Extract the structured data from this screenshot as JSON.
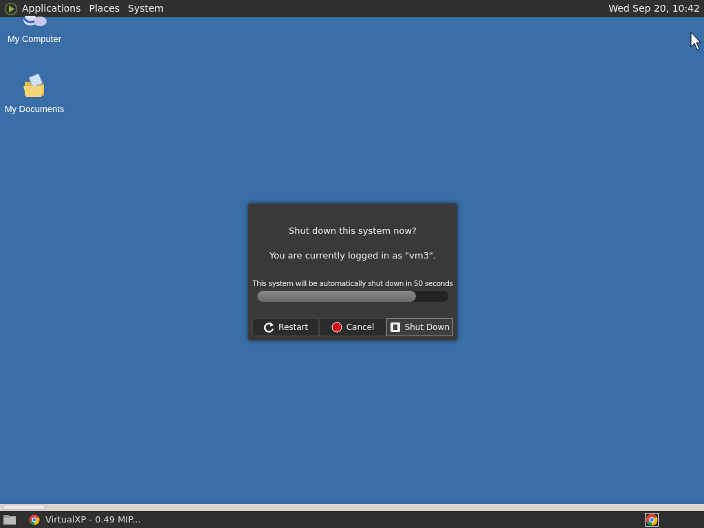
{
  "top_panel": {
    "menus": [
      "Applications",
      "Places",
      "System"
    ],
    "clock": "Wed Sep 20, 10:42"
  },
  "desktop_icons": [
    {
      "label": "My Computer",
      "kind": "computer"
    },
    {
      "label": "My Documents",
      "kind": "documents"
    }
  ],
  "dialog": {
    "title": "Shut down this system now?",
    "message": "You are currently logged in as \"vm3\".",
    "countdown": "This system will be automatically shut down in 50 seconds",
    "level": 0.83,
    "buttons": [
      {
        "label": "Restart",
        "kind": "restart",
        "selected": false
      },
      {
        "label": "Cancel",
        "kind": "cancel",
        "selected": false
      },
      {
        "label": "Shut Down",
        "kind": "shutdown",
        "selected": true
      }
    ]
  },
  "taskbar": {
    "tasks": [
      {
        "label": "VirtualXP - 0.49 MIP..."
      }
    ]
  }
}
